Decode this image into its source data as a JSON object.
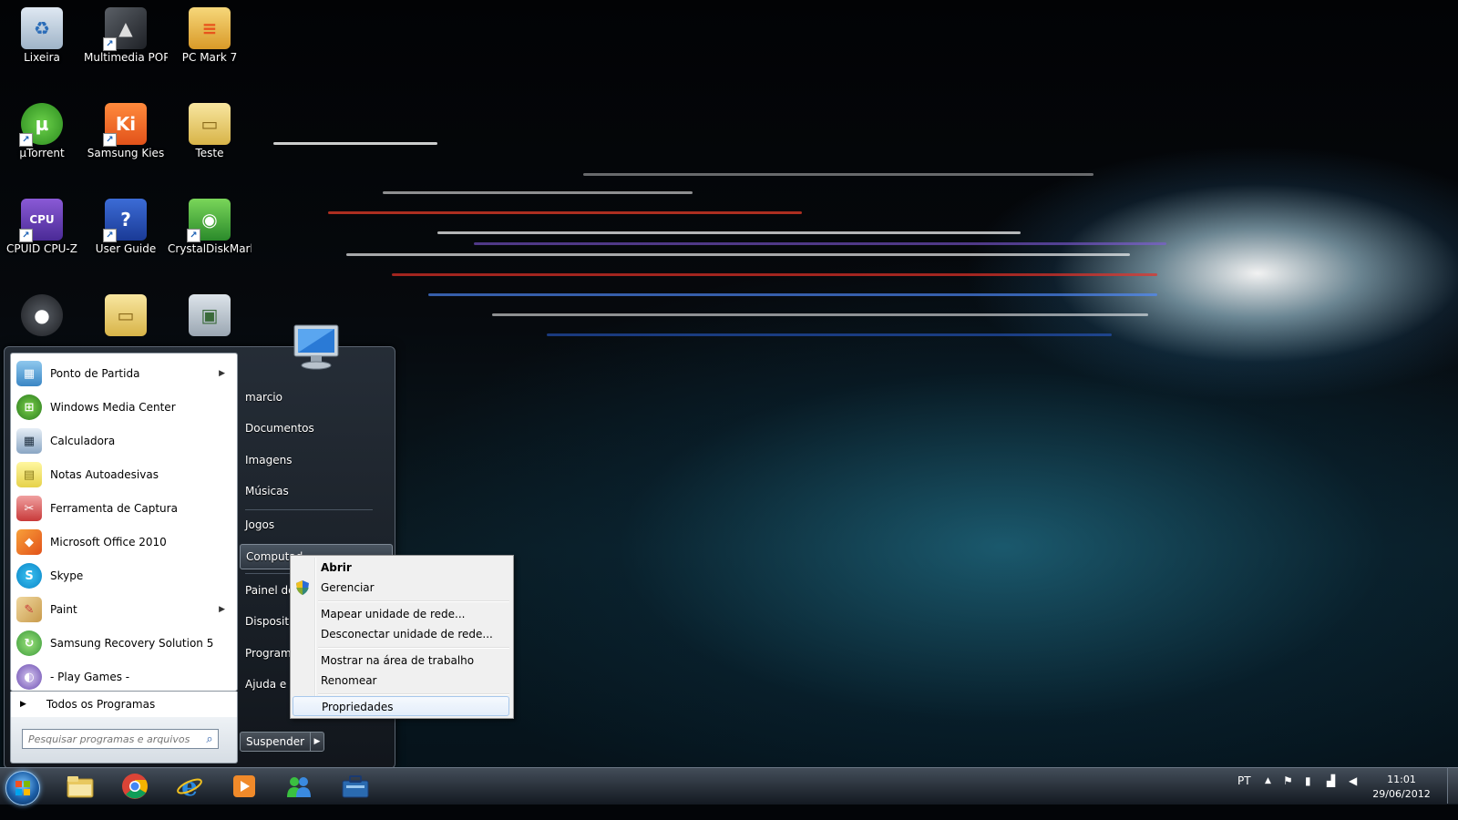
{
  "desktop": {
    "icons": [
      {
        "label": "Lixeira",
        "icon": "recycle-bin-icon"
      },
      {
        "label": "Multimedia POP",
        "icon": "multimedia-pop-icon"
      },
      {
        "label": "PC Mark 7",
        "icon": "pcmark-icon"
      },
      {
        "label": "µTorrent",
        "icon": "utorrent-icon"
      },
      {
        "label": "Samsung Kies",
        "icon": "samsung-kies-icon"
      },
      {
        "label": "Teste",
        "icon": "folder-icon"
      },
      {
        "label": "CPUID CPU-Z",
        "icon": "cpuz-icon"
      },
      {
        "label": "User Guide",
        "icon": "help-icon"
      },
      {
        "label": "CrystalDiskMark",
        "icon": "crystaldiskmark-icon"
      }
    ]
  },
  "start_menu": {
    "programs": [
      {
        "label": "Ponto de Partida",
        "icon": "getting-started-icon",
        "submenu": true
      },
      {
        "label": "Windows Media Center",
        "icon": "media-center-icon",
        "submenu": false
      },
      {
        "label": "Calculadora",
        "icon": "calculator-icon",
        "submenu": false
      },
      {
        "label": "Notas Autoadesivas",
        "icon": "sticky-notes-icon",
        "submenu": false
      },
      {
        "label": "Ferramenta de Captura",
        "icon": "snipping-tool-icon",
        "submenu": false
      },
      {
        "label": "Microsoft Office 2010",
        "icon": "office-icon",
        "submenu": false
      },
      {
        "label": "Skype",
        "icon": "skype-icon",
        "submenu": false
      },
      {
        "label": "Paint",
        "icon": "paint-icon",
        "submenu": true
      },
      {
        "label": "Samsung Recovery Solution 5",
        "icon": "recovery-icon",
        "submenu": false
      },
      {
        "label": "-  Play Games  -",
        "icon": "games-icon",
        "submenu": false
      }
    ],
    "all_programs": "Todos os Programas",
    "search_placeholder": "Pesquisar programas e arquivos",
    "right_items": [
      "marcio",
      "Documentos",
      "Imagens",
      "Músicas",
      "Jogos",
      "Computad",
      "Painel de",
      "Dispositiv",
      "Programa",
      "Ajuda e S"
    ],
    "shutdown_label": "Suspender"
  },
  "context_menu": {
    "items": [
      {
        "label": "Abrir",
        "bold": true
      },
      {
        "label": "Gerenciar",
        "icon": "uac-shield-icon"
      },
      {
        "label": "Mapear unidade de rede..."
      },
      {
        "label": "Desconectar unidade de rede..."
      },
      {
        "label": "Mostrar na área de trabalho"
      },
      {
        "label": "Renomear"
      },
      {
        "label": "Propriedades",
        "highlighted": true
      }
    ]
  },
  "taskbar": {
    "apps": [
      "explorer-icon",
      "chrome-icon",
      "internet-explorer-icon",
      "media-player-icon",
      "messenger-icon",
      "toolbox-icon"
    ],
    "language": "PT",
    "time": "11:01",
    "date": "29/06/2012"
  },
  "colors": {
    "accent": "#1c5fa8",
    "menu_highlight": "#a8c8ec"
  }
}
